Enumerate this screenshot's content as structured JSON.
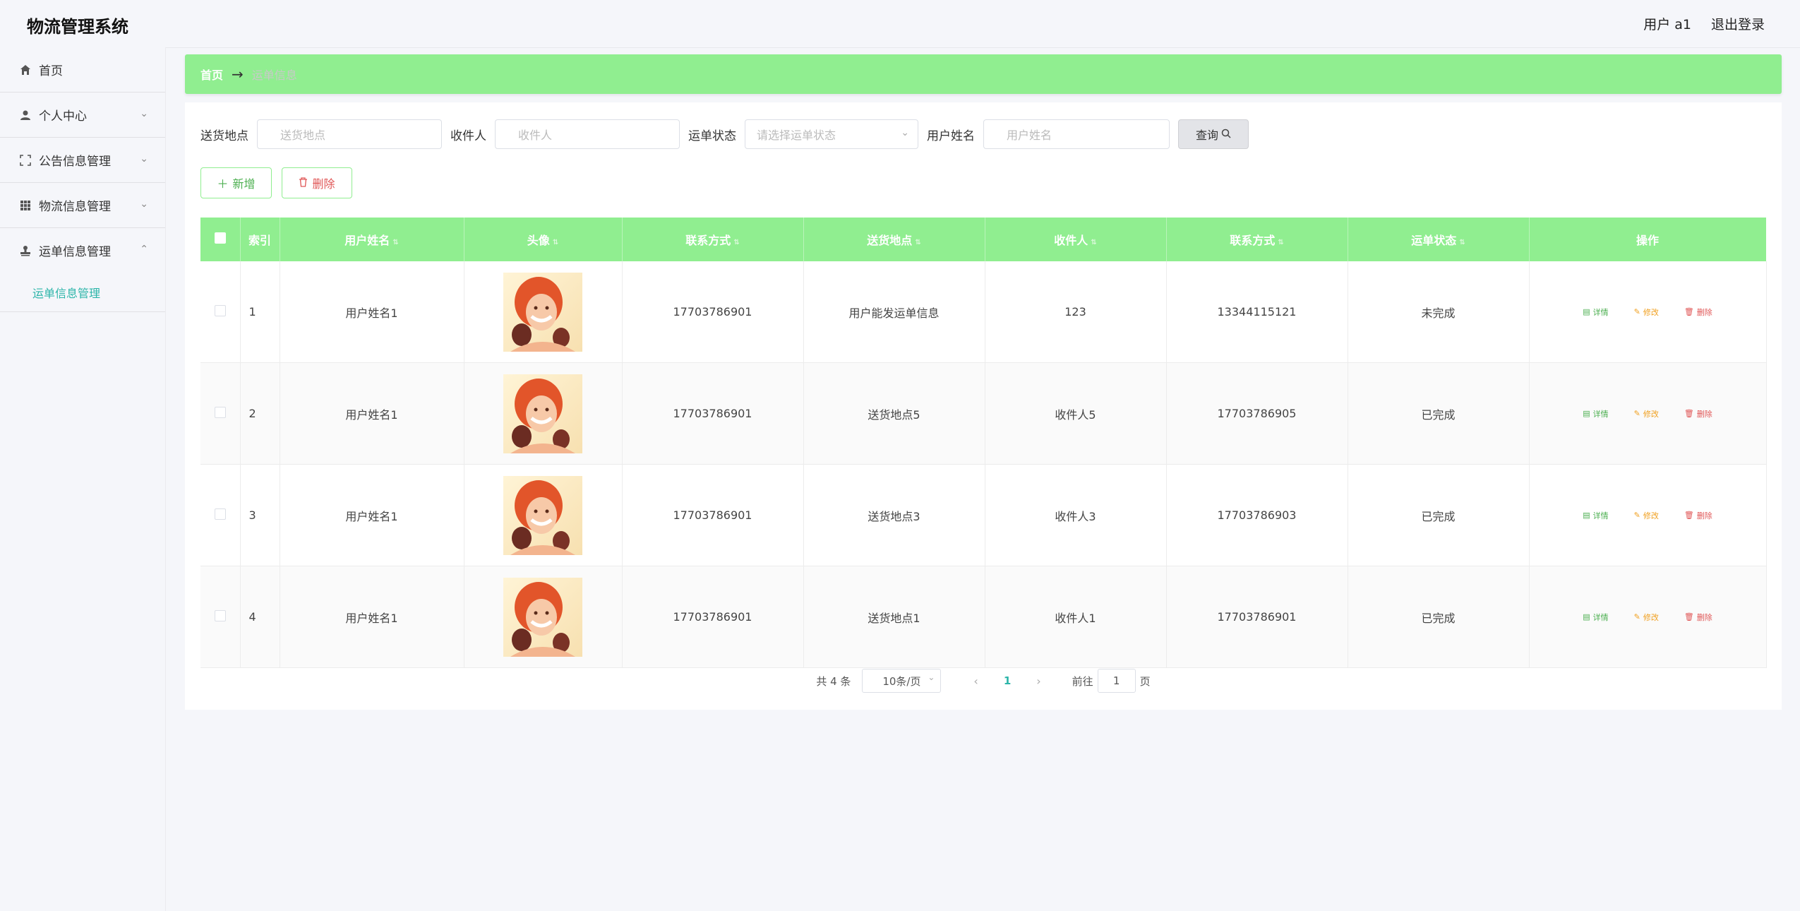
{
  "header": {
    "title": "物流管理系统",
    "user": "用户 a1",
    "logout": "退出登录"
  },
  "sidebar": {
    "items": [
      {
        "label": "首页",
        "icon": "home-icon",
        "chevron": false
      },
      {
        "label": "个人中心",
        "icon": "user-icon",
        "chevron": true
      },
      {
        "label": "公告信息管理",
        "icon": "frame-icon",
        "chevron": true
      },
      {
        "label": "物流信息管理",
        "icon": "grid-icon",
        "chevron": true
      },
      {
        "label": "运单信息管理",
        "icon": "stamp-icon",
        "chevron": true,
        "expanded": true
      }
    ],
    "submenu": {
      "label": "运单信息管理"
    }
  },
  "breadcrumb": {
    "home": "首页",
    "arrow": "→",
    "current": "运单信息"
  },
  "filters": {
    "address_label": "送货地点",
    "address_placeholder": "送货地点",
    "receiver_label": "收件人",
    "receiver_placeholder": "收件人",
    "status_label": "运单状态",
    "status_placeholder": "请选择运单状态",
    "username_label": "用户姓名",
    "username_placeholder": "用户姓名",
    "query_label": "查询"
  },
  "actions": {
    "add_label": "新增",
    "delete_label": "删除"
  },
  "table": {
    "headers": {
      "index": "索引",
      "username": "用户姓名",
      "avatar": "头像",
      "phone": "联系方式",
      "address": "送货地点",
      "receiver": "收件人",
      "receiver_phone": "联系方式",
      "status": "运单状态",
      "ops": "操作"
    },
    "rows": [
      {
        "index": "1",
        "username": "用户姓名1",
        "phone": "17703786901",
        "address": "用户能发运单信息",
        "receiver": "123",
        "receiver_phone": "13344115121",
        "status": "未完成"
      },
      {
        "index": "2",
        "username": "用户姓名1",
        "phone": "17703786901",
        "address": "送货地点5",
        "receiver": "收件人5",
        "receiver_phone": "17703786905",
        "status": "已完成"
      },
      {
        "index": "3",
        "username": "用户姓名1",
        "phone": "17703786901",
        "address": "送货地点3",
        "receiver": "收件人3",
        "receiver_phone": "17703786903",
        "status": "已完成"
      },
      {
        "index": "4",
        "username": "用户姓名1",
        "phone": "17703786901",
        "address": "送货地点1",
        "receiver": "收件人1",
        "receiver_phone": "17703786901",
        "status": "已完成"
      }
    ],
    "ops": {
      "detail": "详情",
      "edit": "修改",
      "delete": "删除"
    }
  },
  "pager": {
    "total": "共 4 条",
    "page_size": "10条/页",
    "current": "1",
    "goto_label": "前往",
    "goto_value": "1",
    "page_label": "页"
  },
  "colors": {
    "accent_green": "#90ee90",
    "teal": "#2cb5a9"
  }
}
